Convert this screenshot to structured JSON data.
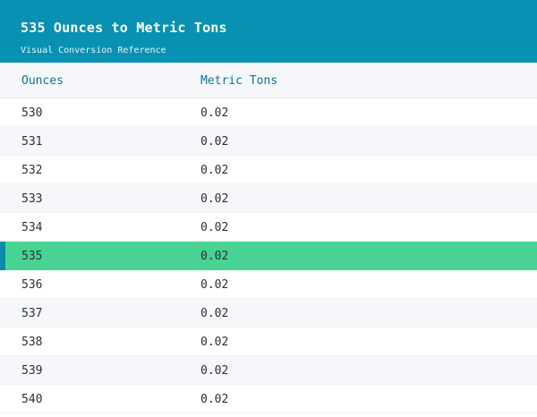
{
  "header": {
    "title": "535 Ounces to Metric Tons",
    "subtitle": "Visual Conversion Reference"
  },
  "table": {
    "columns": [
      "Ounces",
      "Metric Tons"
    ],
    "highlighted_row_index": 5,
    "rows": [
      {
        "ounces": "530",
        "metric_tons": "0.02"
      },
      {
        "ounces": "531",
        "metric_tons": "0.02"
      },
      {
        "ounces": "532",
        "metric_tons": "0.02"
      },
      {
        "ounces": "533",
        "metric_tons": "0.02"
      },
      {
        "ounces": "534",
        "metric_tons": "0.02"
      },
      {
        "ounces": "535",
        "metric_tons": "0.02"
      },
      {
        "ounces": "536",
        "metric_tons": "0.02"
      },
      {
        "ounces": "537",
        "metric_tons": "0.02"
      },
      {
        "ounces": "538",
        "metric_tons": "0.02"
      },
      {
        "ounces": "539",
        "metric_tons": "0.02"
      },
      {
        "ounces": "540",
        "metric_tons": "0.02"
      }
    ]
  },
  "colors": {
    "header_bg": "#0891b2",
    "highlight_bg": "#48d393",
    "highlight_accent": "#0b8aad",
    "column_header_text": "#0e7490"
  }
}
